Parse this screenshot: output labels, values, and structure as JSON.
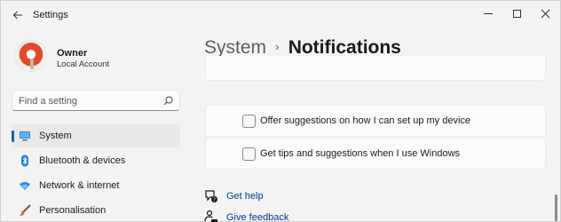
{
  "window": {
    "title": "Settings"
  },
  "profile": {
    "name": "Owner",
    "account_type": "Local Account"
  },
  "search": {
    "placeholder": "Find a setting"
  },
  "sidebar": {
    "items": [
      {
        "label": "System",
        "icon": "monitor-icon",
        "selected": true
      },
      {
        "label": "Bluetooth & devices",
        "icon": "bluetooth-icon",
        "selected": false
      },
      {
        "label": "Network & internet",
        "icon": "wifi-icon",
        "selected": false
      },
      {
        "label": "Personalisation",
        "icon": "brush-icon",
        "selected": false
      }
    ]
  },
  "breadcrumb": {
    "parent": "System",
    "separator": "›",
    "current": "Notifications"
  },
  "options": [
    {
      "label": "Offer suggestions on how I can set up my device",
      "checked": false
    },
    {
      "label": "Get tips and suggestions when I use Windows",
      "checked": false
    }
  ],
  "links": {
    "help": "Get help",
    "feedback": "Give feedback"
  },
  "colors": {
    "accent": "#005fb8",
    "link": "#003e92",
    "background": "#f3f3f3"
  }
}
